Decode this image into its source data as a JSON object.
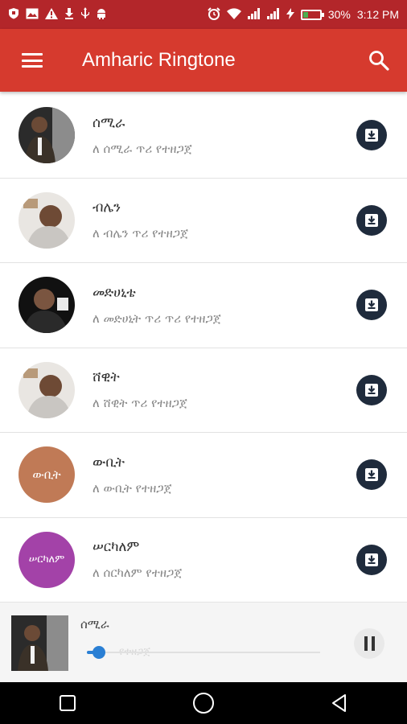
{
  "status_bar": {
    "left_icons": [
      "shield-icon",
      "image-icon",
      "warning-icon",
      "download-icon",
      "usb-icon",
      "android-icon"
    ],
    "right_icons": [
      "alarm-icon",
      "wifi-icon",
      "signal-icon",
      "signal-icon",
      "charging-icon",
      "battery-icon"
    ],
    "battery": "30%",
    "time": "3:12 PM"
  },
  "app_bar": {
    "title": "Amharic Ringtone",
    "menu_icon": "hamburger-icon",
    "search_icon": "search-icon",
    "color": "#d63a2e"
  },
  "ringtones": [
    {
      "title": "ሰሚራ",
      "subtitle": "ለ ሰሚራ ጥሪ የተዘጋጀ",
      "avatar_text": ""
    },
    {
      "title": "ብሌን",
      "subtitle": "ለ ብሌን  ጥሪ የተዘጋጀ",
      "avatar_text": ""
    },
    {
      "title": "መድሀኒቴ",
      "subtitle": "ለ መድሀኒት ጥሪ ጥሪ የተዘጋጀ",
      "avatar_text": ""
    },
    {
      "title": "ሸዊት",
      "subtitle": "ለ ሸዊት ጥሪ የተዘጋጀ",
      "avatar_text": ""
    },
    {
      "title": "ውቢት",
      "subtitle": "ለ ውቢት የተዘጋጀ",
      "avatar_text": "ውቢት"
    },
    {
      "title": "ሠርካለም",
      "subtitle": "ለ ሰርካለም የተዘጋጀ",
      "avatar_text": "ሠርካለም"
    }
  ],
  "player": {
    "title": "ሰሚራ",
    "ghost_text": "የተዘጋጀ",
    "progress": 0.05,
    "state": "playing"
  },
  "nav_bar": {
    "buttons": [
      "recent-apps-icon",
      "home-icon",
      "back-icon"
    ]
  },
  "colors": {
    "status_bar": "#b3262a",
    "app_bar": "#d63a2e",
    "download_button": "#1f2b3c",
    "seek": "#2a7fd4"
  }
}
